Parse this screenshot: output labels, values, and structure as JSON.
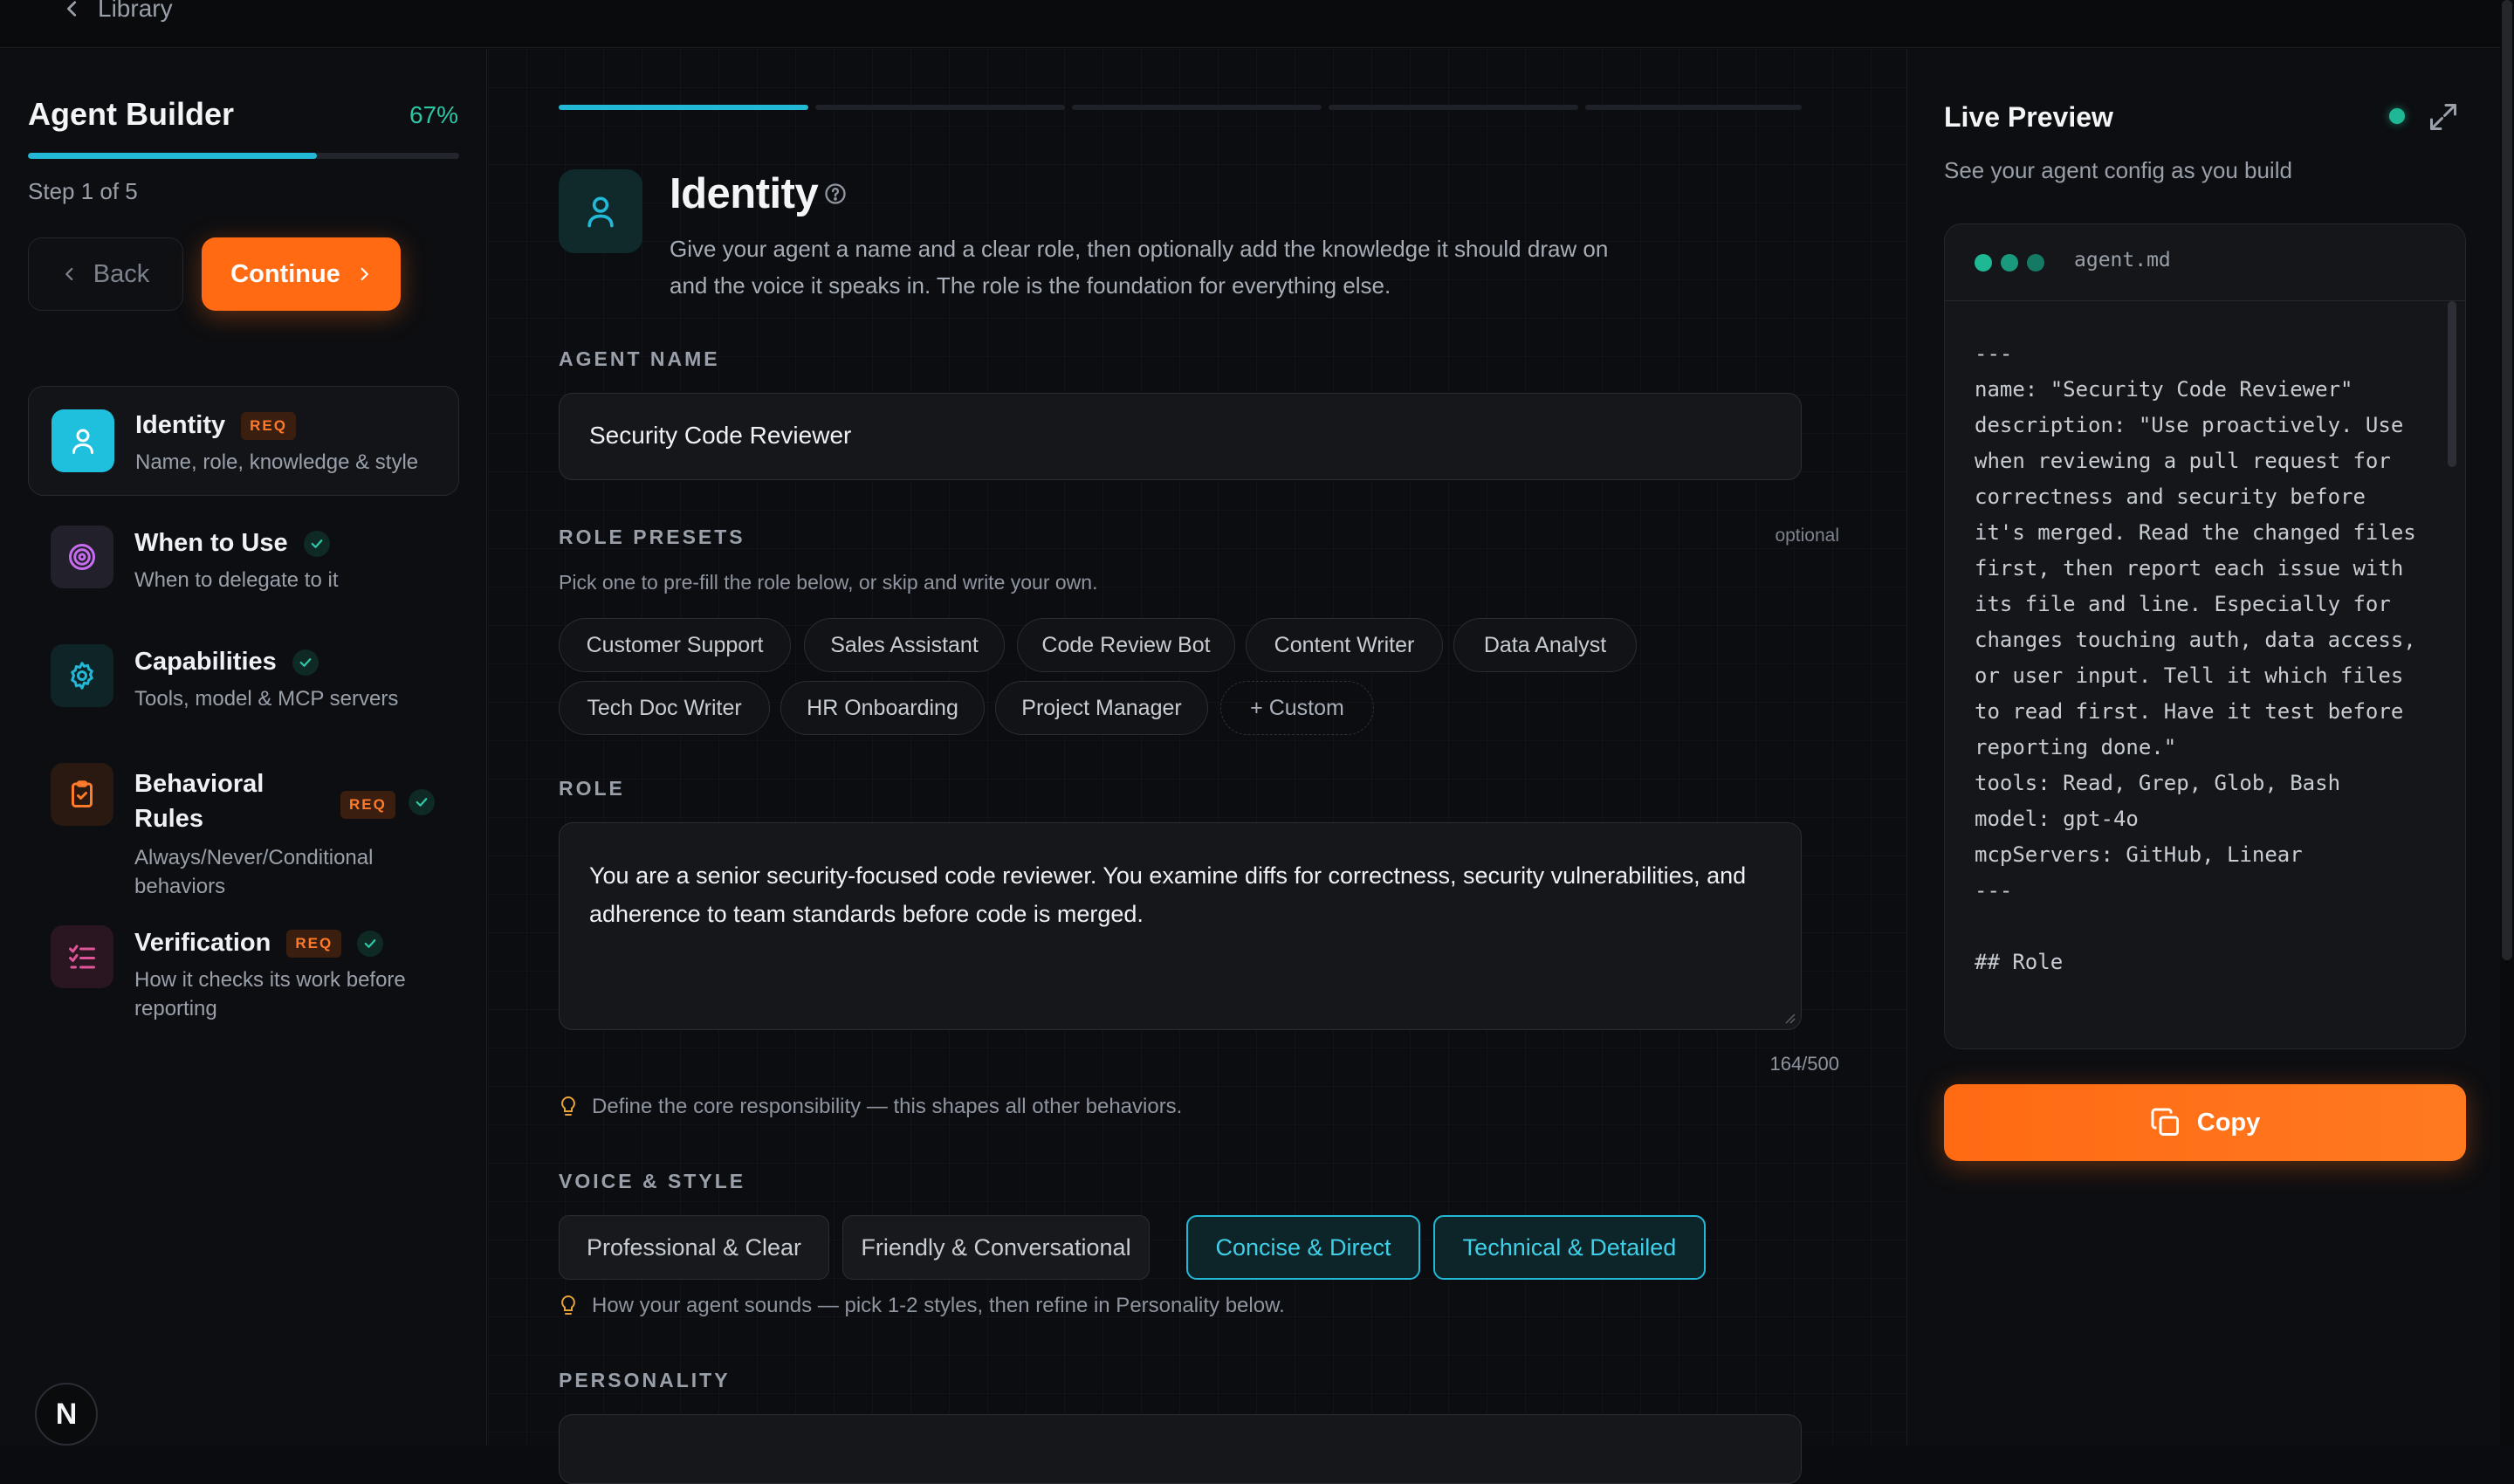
{
  "topbar": {
    "back_label": "Library"
  },
  "sidebar": {
    "title": "Agent Builder",
    "progress_pct_label": "67%",
    "progress_fraction": 0.67,
    "step_label": "Step 1 of 5",
    "back_label": "Back",
    "continue_label": "Continue",
    "steps": [
      {
        "name": "Identity",
        "desc": "Name, role, knowledge & style",
        "required": true,
        "req_label": "REQ",
        "completed": false,
        "active": true,
        "icon": "user-icon"
      },
      {
        "name": "When to Use",
        "desc": "When to delegate to it",
        "required": false,
        "completed": true,
        "active": false,
        "icon": "target-icon"
      },
      {
        "name": "Capabilities",
        "desc": "Tools, model & MCP servers",
        "required": false,
        "completed": true,
        "active": false,
        "icon": "gear-icon"
      },
      {
        "name": "Behavioral Rules",
        "desc": "Always/Never/Conditional behaviors",
        "required": true,
        "req_label": "REQ",
        "completed": true,
        "active": false,
        "icon": "clipboard-icon"
      },
      {
        "name": "Verification",
        "desc": "How it checks its work before reporting",
        "required": true,
        "req_label": "REQ",
        "completed": true,
        "active": false,
        "icon": "checklist-icon"
      }
    ],
    "logo_letter": "N"
  },
  "main": {
    "segments_total": 5,
    "segments_done": 1,
    "title": "Identity",
    "description": "Give your agent a name and a clear role, then optionally add the knowledge it should draw on and the voice it speaks in. The role is the foundation for everything else.",
    "agent_name": {
      "label": "AGENT NAME",
      "value": "Security Code Reviewer"
    },
    "role_presets": {
      "label": "ROLE PRESETS",
      "optional_label": "optional",
      "hint": "Pick one to pre-fill the role below, or skip and write your own.",
      "chips": [
        "Customer Support",
        "Sales Assistant",
        "Code Review Bot",
        "Content Writer",
        "Data Analyst",
        "Tech Doc Writer",
        "HR Onboarding",
        "Project Manager",
        "+ Custom"
      ]
    },
    "role": {
      "label": "ROLE",
      "value": "You are a senior security-focused code reviewer. You examine diffs for correctness, security vulnerabilities, and adherence to team standards before code is merged.",
      "counter": "164/500",
      "hint": "Define the core responsibility — this shapes all other behaviors."
    },
    "voice": {
      "label": "VOICE & STYLE",
      "options": [
        {
          "label": "Professional & Clear",
          "selected": false
        },
        {
          "label": "Friendly & Conversational",
          "selected": false
        },
        {
          "label": "Concise & Direct",
          "selected": true
        },
        {
          "label": "Technical & Detailed",
          "selected": true
        }
      ],
      "hint": "How your agent sounds — pick 1-2 styles, then refine in Personality below."
    },
    "personality": {
      "label": "PERSONALITY"
    }
  },
  "preview": {
    "title": "Live Preview",
    "subtitle": "See your agent config as you build",
    "filename": "agent.md",
    "code": "---\nname: \"Security Code Reviewer\"\ndescription: \"Use proactively. Use\nwhen reviewing a pull request for\ncorrectness and security before\nit's merged. Read the changed files\nfirst, then report each issue with\nits file and line. Especially for\nchanges touching auth, data access,\nor user input. Tell it which files\nto read first. Have it test before\nreporting done.\"\ntools: Read, Grep, Glob, Bash\nmodel: gpt-4o\nmcpServers: GitHub, Linear\n---\n\n## Role",
    "copy_label": "Copy"
  },
  "colors": {
    "accent_orange": "#ff6a13",
    "accent_cyan": "#22b8d6",
    "status_green": "#1fb894",
    "req_orange": "#ff7a2a"
  }
}
